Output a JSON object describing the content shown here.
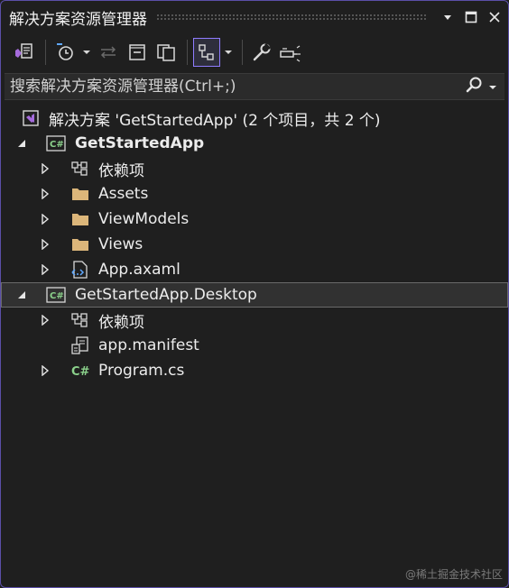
{
  "window": {
    "title": "解决方案资源管理器"
  },
  "search": {
    "placeholder": "搜索解决方案资源管理器(Ctrl+;)"
  },
  "tree": {
    "solution": "解决方案 'GetStartedApp' (2 个项目，共 2 个)",
    "project1": "GetStartedApp",
    "p1_deps": "依赖项",
    "p1_assets": "Assets",
    "p1_viewmodels": "ViewModels",
    "p1_views": "Views",
    "p1_app": "App.axaml",
    "project2": "GetStartedApp.Desktop",
    "p2_deps": "依赖项",
    "p2_manifest": "app.manifest",
    "p2_program": "Program.cs"
  },
  "watermark": "@稀土掘金技术社区",
  "colors": {
    "background": "#1f1f1f",
    "accent": "#8f7cff",
    "folder": "#dcb67a",
    "csharp": "#8bd18b",
    "vs_purple": "#a56bdc"
  }
}
